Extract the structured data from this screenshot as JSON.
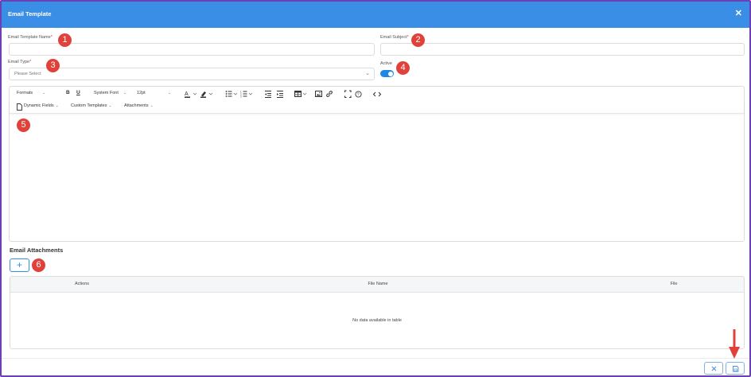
{
  "modal": {
    "title": "Email Template",
    "close_icon": "close-icon"
  },
  "fields": {
    "name_label": "Email Template Name",
    "subject_label": "Email Subject",
    "type_label": "Email Type",
    "type_placeholder": "Please Select",
    "active_label": "Active",
    "required_mark": "*",
    "active": true
  },
  "toolbar": {
    "formats": "Formats",
    "font": "System Font",
    "size": "12pt",
    "dynamic_fields": "Dynamic Fields",
    "custom_templates": "Custom Templates",
    "attachments": "Attachments"
  },
  "attachments": {
    "title": "Email Attachments",
    "add_label": "+",
    "columns": [
      "Actions",
      "File Name",
      "File"
    ],
    "empty": "No data available in table"
  },
  "badges": [
    "1",
    "2",
    "3",
    "4",
    "5",
    "6"
  ],
  "colors": {
    "header": "#3a8ee6",
    "badge": "#e0423b",
    "toggle": "#1e88e5",
    "arrow": "#e0423b"
  }
}
